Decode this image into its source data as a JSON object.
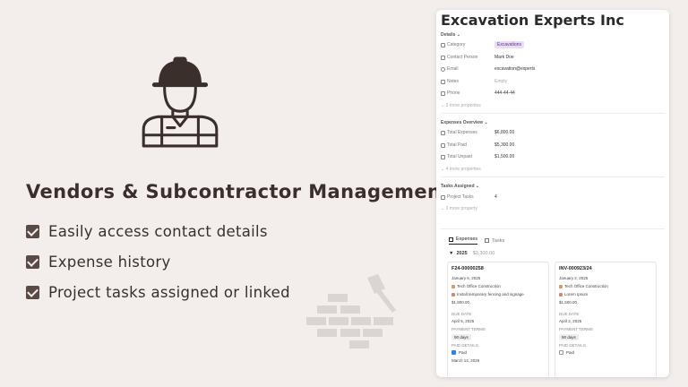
{
  "promo": {
    "headline": "Vendors & Subcontractor Management",
    "features": [
      "Easily access contact details",
      "Expense history",
      "Project tasks assigned or linked"
    ]
  },
  "page": {
    "title": "Excavation Experts Inc",
    "details": {
      "label": "Details",
      "category_label": "Category",
      "category_value": "Excavations",
      "contact_label": "Contact Person",
      "contact_value": "Mark Doe",
      "email_label": "Email",
      "email_value": "excavation@experts",
      "notes_label": "Notes",
      "notes_value": "Empty",
      "phone_label": "Phone",
      "phone_value": "444-44-44",
      "more": "3 more properties"
    },
    "expenses_overview": {
      "label": "Expenses Overview",
      "total_label": "Total Expenses",
      "total_value": "$6,800.00",
      "paid_label": "Total Paid",
      "paid_value": "$5,300.00",
      "unpaid_label": "Total Unpaid",
      "unpaid_value": "$1,500.00",
      "more": "4 more properties"
    },
    "tasks_assigned": {
      "label": "Tasks Assigned",
      "project_tasks_label": "Project Tasks",
      "project_tasks_value": "4",
      "more": "1 more property"
    },
    "tabs": [
      "Expenses",
      "Tasks"
    ],
    "group": {
      "year": "2025",
      "sum": "$3,300.00"
    },
    "expenses": [
      {
        "id": "F24-00000258",
        "date": "January 6, 2025",
        "project": "Tech Office Construction",
        "item": "Install temporary fencing and signage",
        "amount": "$1,800.00",
        "due_label": "DUE DATE",
        "due": "April 5, 2025",
        "terms_label": "PAYMENT TERMS",
        "terms": "90 days",
        "paid_details_label": "PAID DETAILS",
        "paid_label": "Paid",
        "paid_date": "March 14, 2025"
      },
      {
        "id": "INV-000923/24",
        "date": "January 2, 2025",
        "project": "Tech Office Construction",
        "item": "Lorem Ipsum",
        "amount": "$1,500.00",
        "due_label": "DUE DATE",
        "due": "April 2, 2025",
        "terms_label": "PAYMENT TERMS",
        "terms": "90 days",
        "paid_details_label": "PAID DETAILS",
        "paid_label": "Paid"
      }
    ]
  },
  "colors": {
    "accent_brown": "#5a4a46",
    "tag_purple": "#eadcf5",
    "check_blue": "#2f80ed"
  },
  "icons": [
    "worker-icon",
    "brick-trowel-icon",
    "checkbox-icon",
    "table-icon"
  ]
}
